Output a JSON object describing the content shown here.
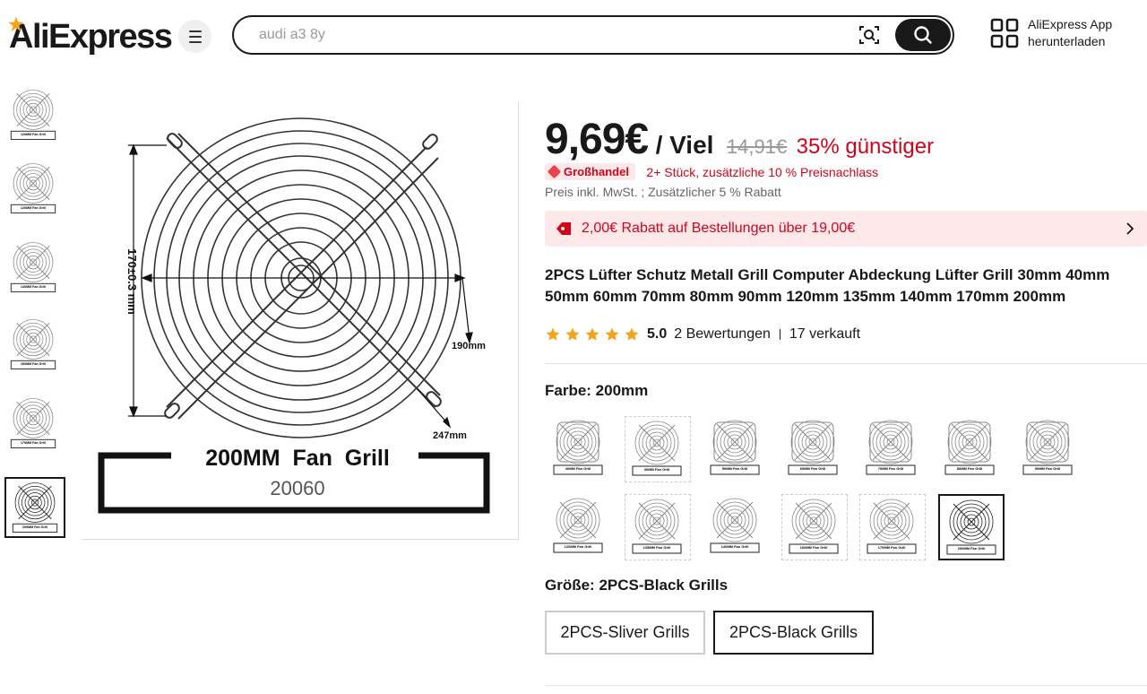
{
  "header": {
    "logo_text": "AliExpress",
    "search_placeholder": "audi a3 8y",
    "app_line1": "AliExpress App",
    "app_line2": "herunterladen",
    "icons": [
      "menu-icon",
      "camera-search-icon",
      "search-icon",
      "qr-code-icon"
    ]
  },
  "gallery": {
    "thumbnails": [
      "120MM Fan Grill",
      "120MM Fan Grill",
      "140MM Fan Grill",
      "160MM Fan Grill",
      "170MM Fan Grill",
      "200MM Fan Grill"
    ],
    "active_thumbnail": 5,
    "main_image": {
      "label": "200MM  Fan  Grill",
      "code": "20060",
      "dim_vertical": "170±0.3 mm",
      "dim_diameter": "190mm",
      "dim_outer": "247mm"
    }
  },
  "product": {
    "price": "9,69€",
    "unit": "/ Viel",
    "old_price": "14,91€",
    "discount": "35% günstiger",
    "wholesale_badge": "Großhandel",
    "wholesale_text": "2+ Stück, zusätzliche 10 % Preisnachlass",
    "vat_text": "Preis inkl. MwSt. ; Zusätzlicher 5 % Rabatt",
    "coupon_text": "2,00€ Rabatt auf Bestellungen über 19,00€",
    "title": "2PCS Lüfter Schutz Metall Grill Computer Abdeckung Lüfter Grill 30mm 40mm 50mm 60mm 70mm 80mm 90mm 120mm 135mm 140mm 170mm 200mm",
    "rating": "5.0",
    "reviews": "2 Bewertungen",
    "sold": "17 verkauft",
    "color_label": "Farbe: 200mm",
    "color_options": [
      "40MM Fan Grill",
      "30MM Fan Grill",
      "50MM Fan Grill",
      "60MM Fan Grill",
      "70MM Fan Grill",
      "80MM Fan Grill",
      "90MM Fan Grill",
      "120MM Fan Grill",
      "135MM Fan Grill",
      "140MM Fan Grill",
      "160MM Fan Grill",
      "170MM Fan Grill",
      "200MM Fan Grill"
    ],
    "selected_color": 12,
    "size_label": "Größe: 2PCS-Black Grills",
    "size_options": [
      "2PCS-Sliver Grills",
      "2PCS-Black Grills"
    ],
    "selected_size": 1
  },
  "colors": {
    "accent_red": "#d3031c",
    "badge_bg": "#fde8ea",
    "star": "#f7a21b",
    "text": "#191919"
  }
}
